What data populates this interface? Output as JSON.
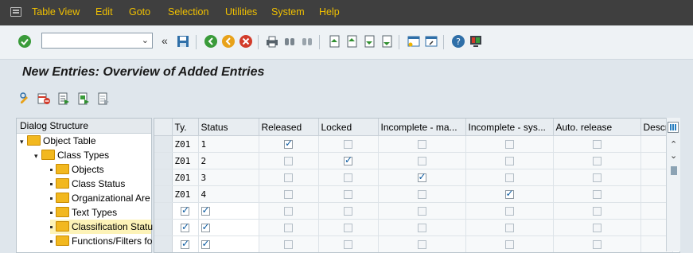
{
  "menu": [
    "Table View",
    "Edit",
    "Goto",
    "Selection",
    "Utilities",
    "System",
    "Help"
  ],
  "title": "New Entries: Overview of Added Entries",
  "dialog": {
    "header": "Dialog Structure",
    "items": [
      {
        "label": "Object Table",
        "level": 0,
        "expanded": true
      },
      {
        "label": "Class Types",
        "level": 1,
        "expanded": true
      },
      {
        "label": "Objects",
        "level": 2
      },
      {
        "label": "Class Status",
        "level": 2
      },
      {
        "label": "Organizational Are",
        "level": 2
      },
      {
        "label": "Text Types",
        "level": 2
      },
      {
        "label": "Classification Statu",
        "level": 2,
        "selected": true
      },
      {
        "label": "Functions/Filters fo",
        "level": 2
      }
    ]
  },
  "grid": {
    "columns": [
      "Ty.",
      "Status",
      "Released",
      "Locked",
      "Incomplete - ma...",
      "Incomplete - sys...",
      "Auto. release",
      "Descr"
    ],
    "rows": [
      {
        "ty": "Z01",
        "status": "1",
        "checks": [
          true,
          false,
          false,
          false,
          false
        ],
        "editable": false
      },
      {
        "ty": "Z01",
        "status": "2",
        "checks": [
          false,
          true,
          false,
          false,
          false
        ],
        "editable": false
      },
      {
        "ty": "Z01",
        "status": "3",
        "checks": [
          false,
          false,
          true,
          false,
          false
        ],
        "editable": false
      },
      {
        "ty": "Z01",
        "status": "4",
        "checks": [
          false,
          false,
          false,
          true,
          false
        ],
        "editable": false
      },
      {
        "ty": "",
        "status": "",
        "checks": [
          false,
          false,
          false,
          false,
          false
        ],
        "editable": true
      },
      {
        "ty": "",
        "status": "",
        "checks": [
          false,
          false,
          false,
          false,
          false
        ],
        "editable": true
      },
      {
        "ty": "",
        "status": "",
        "checks": [
          false,
          false,
          false,
          false,
          false
        ],
        "editable": true
      }
    ]
  },
  "colors": {
    "menu_bg": "#3f3f3f",
    "menu_text": "#f0c000",
    "screen_bg": "#dfe6ec",
    "check": "#0a5aa0"
  }
}
